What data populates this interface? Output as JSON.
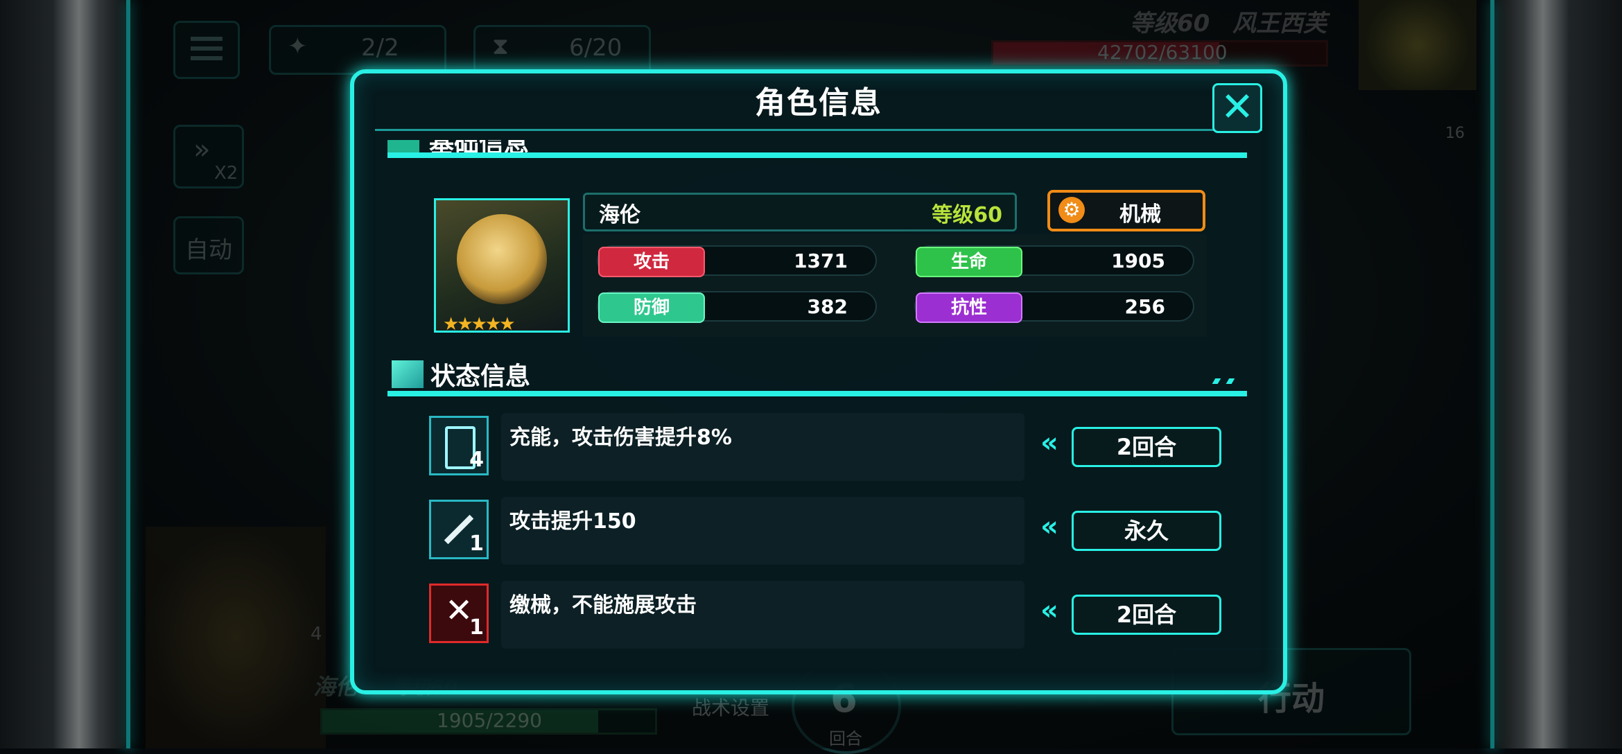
{
  "hud": {
    "top_counter_1": "2/2",
    "top_counter_2": "6/20",
    "speed_label": "X2",
    "auto_label": "自动",
    "enemy_level": "等级60",
    "enemy_name": "风王西芙",
    "enemy_hp": "42702/63100",
    "enemy_hp_fraction": 0.677,
    "enemy_badge_count": "16",
    "player_name": "海伦",
    "player_level": "等级60",
    "player_hp": "1905/2290",
    "player_hp_fraction": 0.832,
    "player_buff_count": "4",
    "tactics_label": "战术设置",
    "round_number": "6",
    "round_label": "回合",
    "action_label": "行动"
  },
  "dialog": {
    "title": "角色信息",
    "close_glyph": "✕",
    "basic_section_title": "基础信息",
    "status_section_title": "状态信息"
  },
  "character": {
    "name": "海伦",
    "level": "等级60",
    "type": "机械",
    "rarity_stars": "★★★★★",
    "stats": {
      "attack_label": "攻击",
      "attack_value": "1371",
      "hp_label": "生命",
      "hp_value": "1905",
      "defense_label": "防御",
      "defense_value": "382",
      "resist_label": "抗性",
      "resist_value": "256"
    }
  },
  "statuses": [
    {
      "icon": "battery-icon",
      "count": "4",
      "description": "充能，攻击伤害提升8%",
      "duration": "2回合"
    },
    {
      "icon": "sword-up-icon",
      "count": "1",
      "description": "攻击提升150",
      "duration": "永久"
    },
    {
      "icon": "disarm-icon",
      "count": "1",
      "description": "缴械，不能施展攻击",
      "duration": "2回合"
    }
  ],
  "colors": {
    "accent": "#29f0e4",
    "attack": "#d0283f",
    "hp": "#2fc24a",
    "defense": "#2ec88f",
    "resist": "#9b2fd1",
    "type_border": "#f08c17",
    "level": "#b9e33b"
  }
}
